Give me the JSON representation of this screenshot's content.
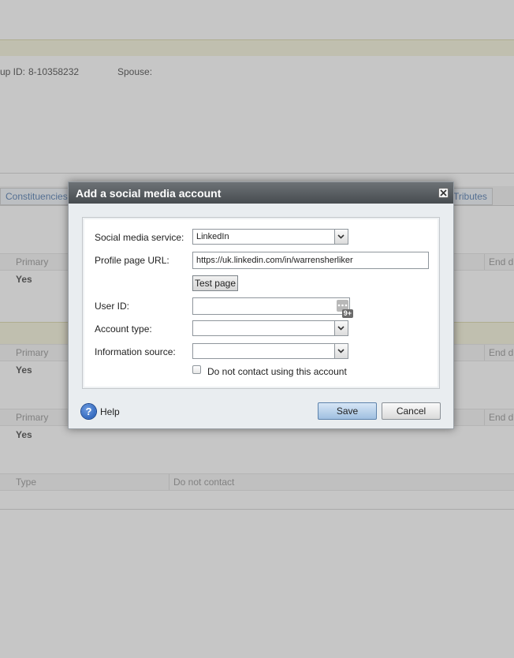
{
  "background": {
    "lookup_id_label": "up ID:",
    "lookup_id_value": "8-10358232",
    "spouse_label": "Spouse:",
    "tabs": [
      "Constituencies",
      "Tributes"
    ],
    "table1": {
      "col_primary": "Primary",
      "col_end": "End d",
      "row_value": "Yes"
    },
    "table2": {
      "col_primary": "Primary",
      "col_end": "End d",
      "row_value": "Yes"
    },
    "table3": {
      "col_primary": "Primary",
      "col_end": "End d",
      "row_value": "Yes"
    },
    "table4": {
      "col_type": "Type",
      "col_do_not_contact": "Do not contact"
    }
  },
  "dialog": {
    "title": "Add a social media account",
    "fields": {
      "service_label": "Social media service:",
      "service_value": "LinkedIn",
      "url_label": "Profile page URL:",
      "url_value": "https://uk.linkedin.com/in/warrensherliker",
      "test_page_label": "Test page",
      "user_id_label": "User ID:",
      "user_id_value": "",
      "user_id_badge": "9+",
      "account_type_label": "Account type:",
      "account_type_value": "",
      "info_source_label": "Information source:",
      "info_source_value": "",
      "do_not_contact_label": "Do not contact using this account",
      "do_not_contact_checked": false
    },
    "footer": {
      "help_label": "Help",
      "save_label": "Save",
      "cancel_label": "Cancel"
    }
  },
  "icons": {
    "close": "close-icon",
    "dropdown": "chevron-down-icon",
    "help": "help-icon",
    "more": "ellipsis-icon"
  },
  "colors": {
    "title_bar": "#474c50",
    "save_button": "#9fbfe0",
    "link_tab": "#3b6aa6"
  }
}
